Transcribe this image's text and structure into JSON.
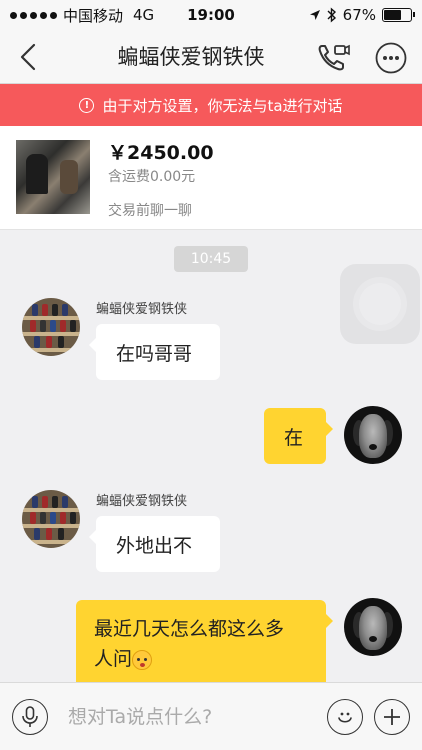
{
  "status_bar": {
    "carrier": "中国移动",
    "network": "4G",
    "time": "19:00",
    "battery": "67%",
    "battery_level": 0.67
  },
  "nav": {
    "title": "蝙蝠侠爱钢铁侠",
    "back_icon": "chevron-left-icon",
    "call_icon": "phone-video-icon",
    "more_icon": "more-dots-icon"
  },
  "notice": {
    "text": "由于对方设置，你无法与ta进行对话",
    "color": "#f6595b"
  },
  "product": {
    "price": "￥2450.00",
    "shipping": "含运费0.00元",
    "chat_before": "交易前聊一聊"
  },
  "chat": {
    "timestamp": "10:45",
    "messages": [
      {
        "direction": "in",
        "sender": "蝙蝠侠爱钢铁侠",
        "text": "在吗哥哥"
      },
      {
        "direction": "out",
        "text": "在"
      },
      {
        "direction": "in",
        "sender": "蝙蝠侠爱钢铁侠",
        "text": "外地出不"
      },
      {
        "direction": "out",
        "text_line1": "最近几天怎么都这么多",
        "text_line2": "人问"
      }
    ]
  },
  "input": {
    "placeholder": "想对Ta说点什么?"
  },
  "colors": {
    "accent_yellow": "#ffd430",
    "notice_red": "#f6595b"
  }
}
